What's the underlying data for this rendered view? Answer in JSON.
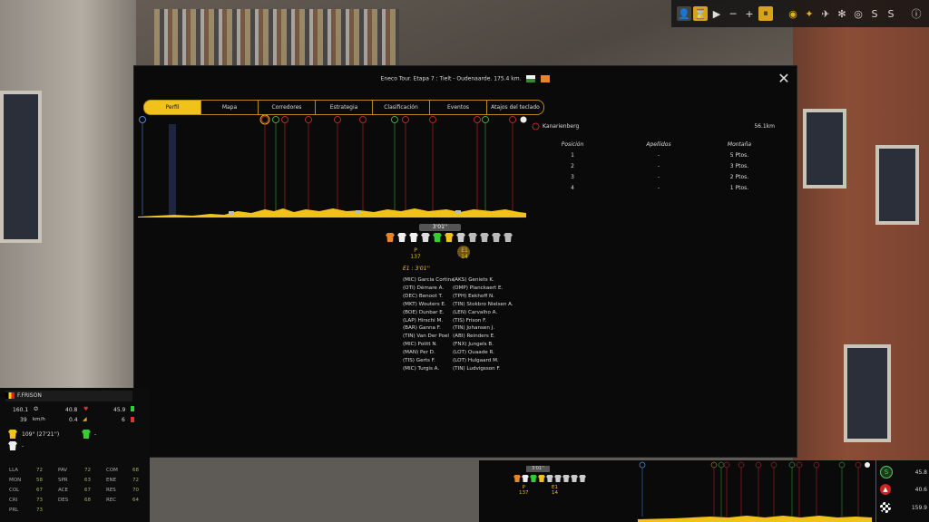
{
  "stage": {
    "title": "Eneco Tour. Etapa 7 : Tielt - Oudenaarde. 175.4 km."
  },
  "tabs": [
    "Perfil",
    "Mapa",
    "Corredores",
    "Estrategia",
    "Clasificación",
    "Eventos",
    "Atajos del teclado"
  ],
  "active_tab": "Perfil",
  "climb": {
    "name": "Kanarienberg",
    "distance": "56.1km"
  },
  "kom_table": {
    "headers": [
      "Posición",
      "Apellidos",
      "Montaña"
    ],
    "rows": [
      [
        "1",
        "-",
        "5 Ptos."
      ],
      [
        "2",
        "-",
        "3 Ptos."
      ],
      [
        "3",
        "-",
        "2 Ptos."
      ],
      [
        "4",
        "-",
        "1 Ptos."
      ]
    ]
  },
  "group": {
    "gap": "3'01''",
    "p_label": "P",
    "p_count": "137",
    "e1_label": "E1",
    "e1_count": "14",
    "e1_time": "E1 : 3'01''"
  },
  "breakaway_col1": [
    "(MIC) Garcia Cortina",
    "(OTI) Démare A.",
    "(DEC) Benoot T.",
    "(MKT) Wouters E.",
    "(BOE) Dunbar E.",
    "(LAP) Hirschi M.",
    "(BAR) Ganna F.",
    "(TIN) Van Der Poel",
    "(MIC) Politt N.",
    "(MAN) Per D.",
    "(TIS) Gerts F.",
    "(MIC) Turgis A."
  ],
  "breakaway_col2": [
    "(AKS) Geniets K.",
    "(OMP) Planckaert E.",
    "(TPH) Eekhoff N.",
    "(TIN) Stokbro Nielsen A.",
    "(LEN) Carvalho A.",
    "(TIS) Frison F.",
    "(TIN) Johansen J.",
    "(ABI) Reinders E.",
    "(FNX) Jungels B.",
    "(LOT) Quaade R.",
    "(LOT) Hulgaard M.",
    "(TIN) Ludvigsson F."
  ],
  "rider": {
    "name": "F.FRISON",
    "distance": "160.1",
    "speed": "39",
    "speed_unit": "km/h",
    "power": "40.8",
    "slope": "0.4",
    "hr": "45.9",
    "val6": "6",
    "rank": "109° (27'21'')",
    "dash": "-",
    "dash2": "-"
  },
  "attributes": [
    [
      "LLA",
      "72"
    ],
    [
      "MON",
      "58"
    ],
    [
      "COL",
      "67"
    ],
    [
      "CRI",
      "73"
    ],
    [
      "PRL",
      "73"
    ],
    [
      "PAV",
      "72"
    ],
    [
      "SPR",
      "63"
    ],
    [
      "ACE",
      "67"
    ],
    [
      "DES",
      "68"
    ],
    [
      "COM",
      "68"
    ],
    [
      "ENE",
      "72"
    ],
    [
      "RES",
      "70"
    ],
    [
      "REC",
      "64"
    ]
  ],
  "mini": {
    "gap": "3'01''",
    "p_label": "P",
    "p_count": "137",
    "e1_label": "E1",
    "e1_count": "14"
  },
  "right_stats": {
    "sprint_km": "45.8",
    "kom_km": "40.6",
    "finish_km": "159.9"
  }
}
